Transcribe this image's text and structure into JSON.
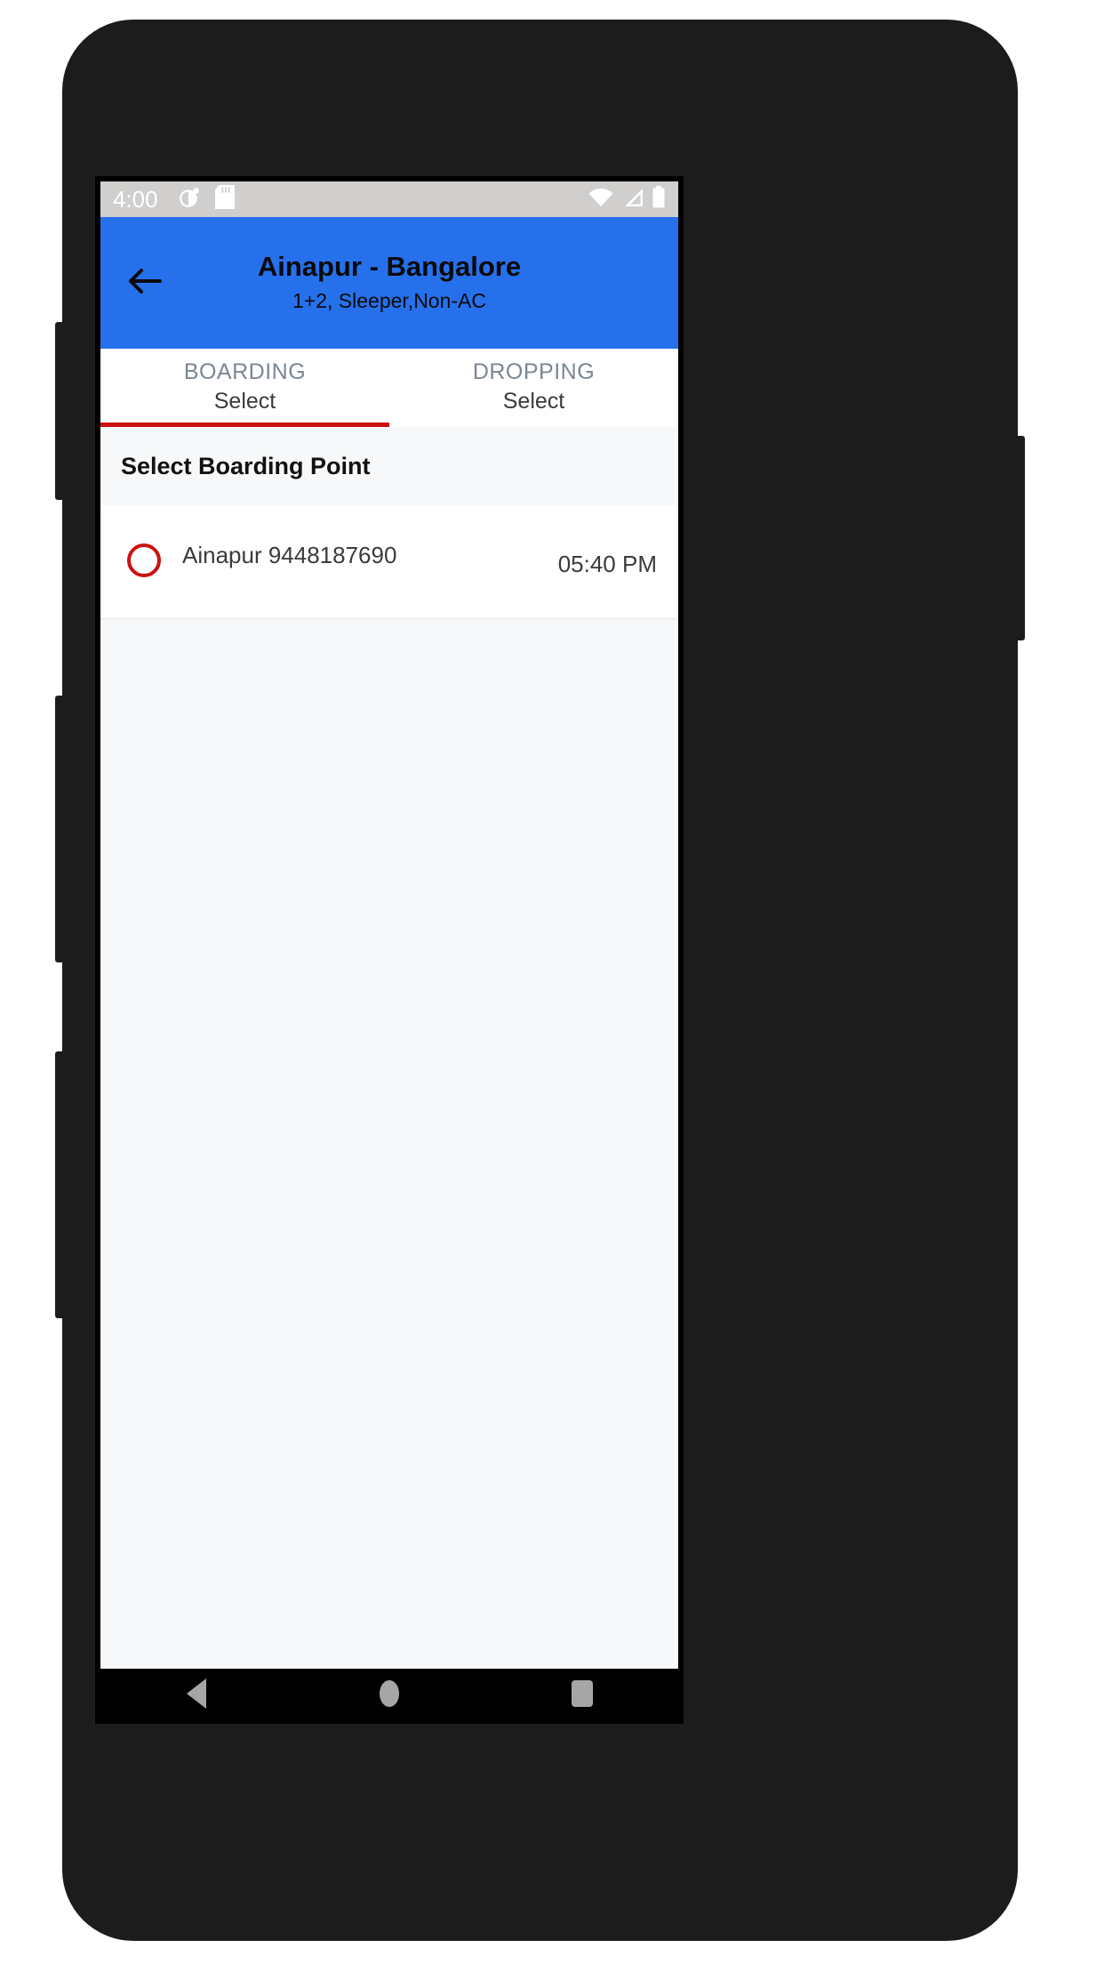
{
  "status_bar": {
    "time": "4:00",
    "left_icons": [
      "contrast-circle-icon",
      "sd-card-icon"
    ],
    "right_icons": [
      "wifi-icon",
      "cellular-signal-icon",
      "battery-icon"
    ],
    "background_color": "#d0cfcd"
  },
  "app_bar": {
    "back_icon": "back-arrow-icon",
    "title": "Ainapur - Bangalore",
    "subtitle": "1+2, Sleeper,Non-AC",
    "background_color": "#2770ec"
  },
  "tabs": [
    {
      "title": "BOARDING",
      "value": "Select",
      "active": true
    },
    {
      "title": "DROPPING",
      "value": "Select",
      "active": false
    }
  ],
  "tab_indicator_color": "#cc1111",
  "section": {
    "header": "Select Boarding Point"
  },
  "boarding_points": [
    {
      "label": "Ainapur 9448187690",
      "time": "05:40 PM",
      "selected": false
    }
  ],
  "nav_bar": {
    "back_label": "back-triangle-icon",
    "home_label": "home-circle-icon",
    "recents_label": "recents-square-icon"
  }
}
